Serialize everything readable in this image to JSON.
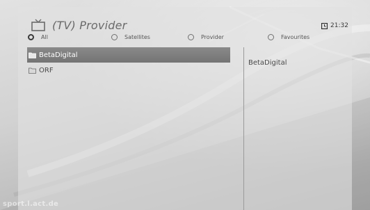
{
  "header": {
    "title": "(TV) Provider",
    "tv_icon": "tv-icon",
    "clock_icon": "clock-icon",
    "time": "21:32"
  },
  "filters": [
    {
      "label": "All",
      "selected": true
    },
    {
      "label": "Satellites",
      "selected": false
    },
    {
      "label": "Provider",
      "selected": false
    },
    {
      "label": "Favourites",
      "selected": false
    }
  ],
  "providers": [
    {
      "label": "BetaDigital",
      "icon": "folder-icon",
      "selected": true
    },
    {
      "label": "ORF",
      "icon": "folder-icon",
      "selected": false
    }
  ],
  "detail": {
    "label": "BetaDigital"
  },
  "watermark": "sport.l.act.de",
  "colors": {
    "selection": "#7e7e7e",
    "text": "#4a4a4a",
    "title": "#6a6a6a"
  }
}
